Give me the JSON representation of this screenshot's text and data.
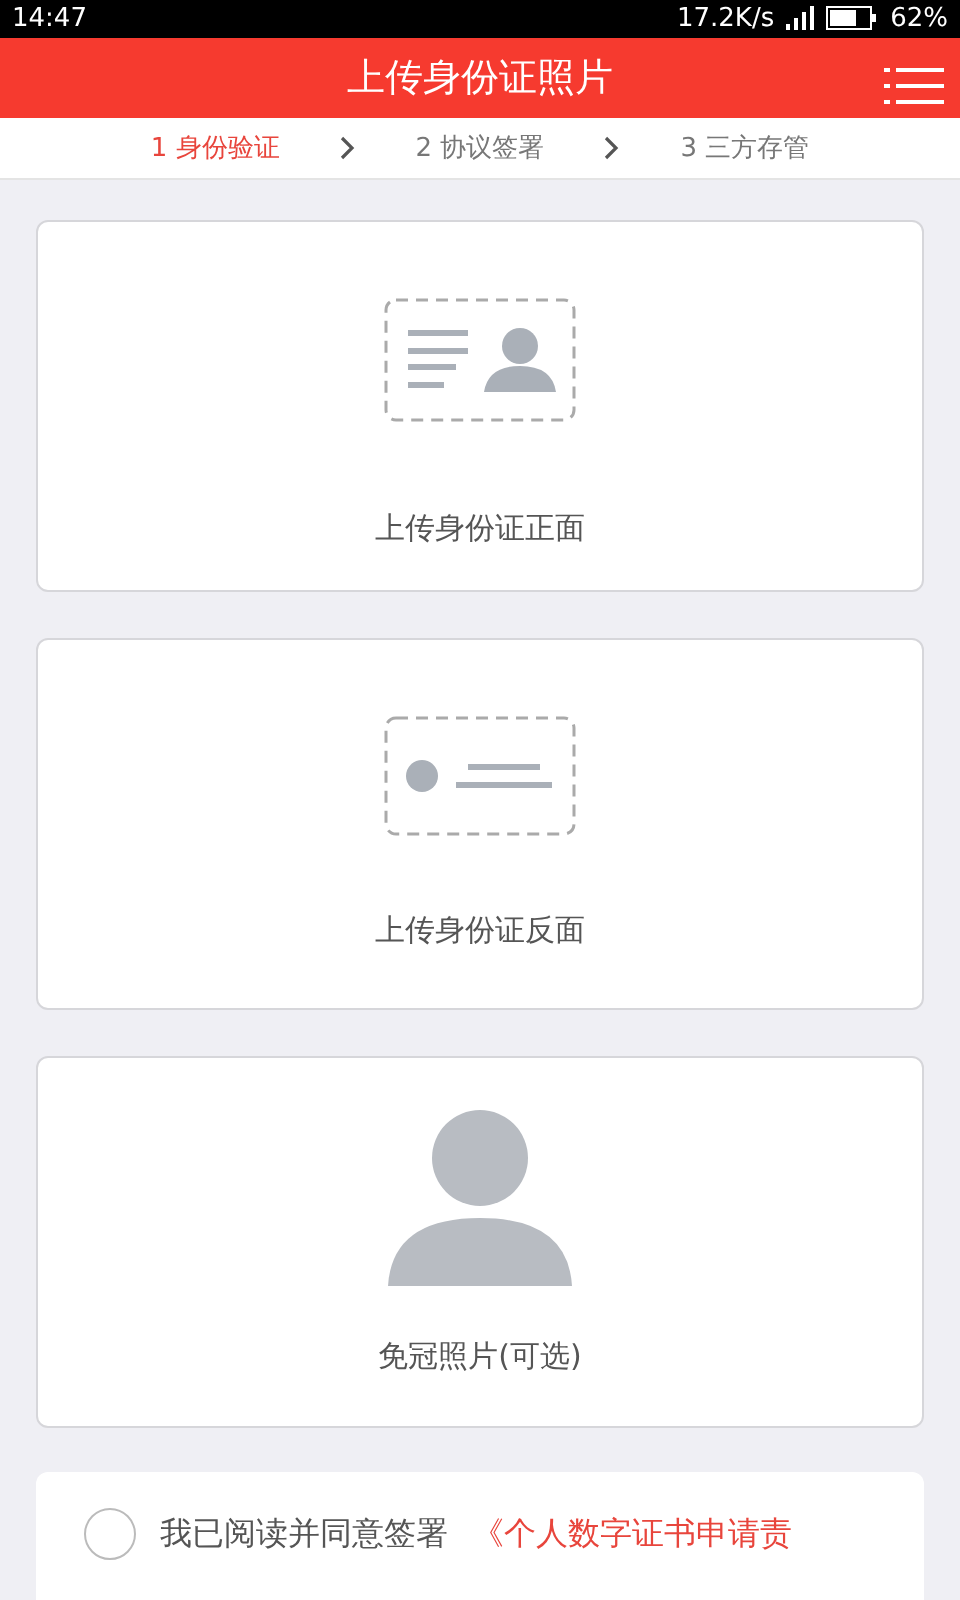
{
  "status_bar": {
    "time": "14:47",
    "speed": "17.2K/s",
    "battery": "62%"
  },
  "header": {
    "title": "上传身份证照片"
  },
  "steps": [
    {
      "label": "1 身份验证",
      "selected": true
    },
    {
      "label": "2 协议签署",
      "selected": false
    },
    {
      "label": "3 三方存管",
      "selected": false
    }
  ],
  "uploads": [
    {
      "kind": "front",
      "label": "上传身份证正面"
    },
    {
      "kind": "back",
      "label": "上传身份证反面"
    },
    {
      "kind": "portrait",
      "label": "免冠照片(可选)"
    }
  ],
  "agreement": {
    "checked": false,
    "text": "我已阅读并同意签署",
    "link": "《个人数字证书申请责"
  }
}
